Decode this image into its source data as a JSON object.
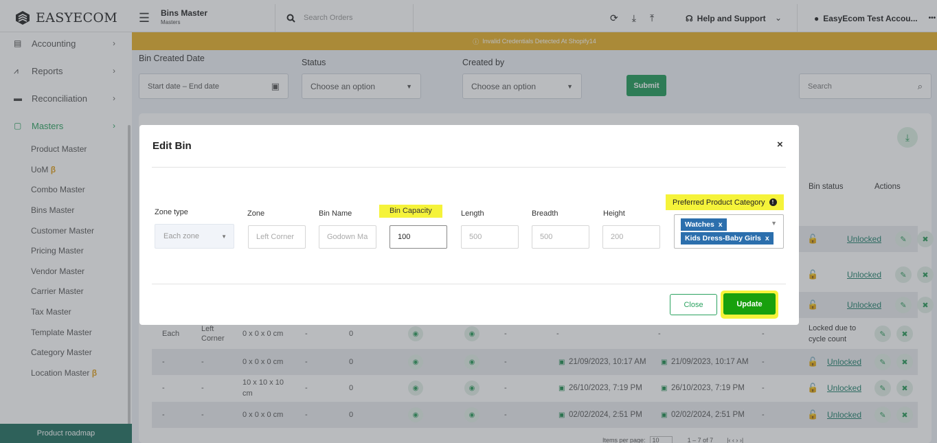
{
  "header": {
    "logo_text": "EASYECOM",
    "page_title": "Bins Master",
    "page_subtitle": "Masters",
    "search_placeholder": "Search Orders",
    "help_label": "Help and Support",
    "account_label": "EasyEcom Test Accou...",
    "more_label": "•••"
  },
  "sidebar": {
    "items": [
      {
        "label": "Accounting",
        "icon": "ledger-icon"
      },
      {
        "label": "Reports",
        "icon": "chart-icon"
      },
      {
        "label": "Reconciliation",
        "icon": "wallet-icon"
      },
      {
        "label": "Masters",
        "icon": "folder-icon"
      }
    ],
    "subitems": [
      {
        "label": "Product Master",
        "beta": ""
      },
      {
        "label": "UoM",
        "beta": "β"
      },
      {
        "label": "Combo Master",
        "beta": ""
      },
      {
        "label": "Bins Master",
        "beta": ""
      },
      {
        "label": "Customer Master",
        "beta": ""
      },
      {
        "label": "Pricing Master",
        "beta": ""
      },
      {
        "label": "Vendor Master",
        "beta": ""
      },
      {
        "label": "Carrier Master",
        "beta": ""
      },
      {
        "label": "Tax Master",
        "beta": ""
      },
      {
        "label": "Template Master",
        "beta": ""
      },
      {
        "label": "Category Master",
        "beta": ""
      },
      {
        "label": "Location Master",
        "beta": "β"
      }
    ],
    "roadmap_label": "Product roadmap"
  },
  "banner": {
    "text": "Invalid Credentials Detected At Shopify14"
  },
  "filters": {
    "bin_created_date_label": "Bin Created Date",
    "date_placeholder": "Start date – End date",
    "status_label": "Status",
    "status_placeholder": "Choose an option",
    "created_by_label": "Created by",
    "created_by_placeholder": "Choose an option",
    "submit_label": "Submit",
    "search_placeholder": "Search"
  },
  "table": {
    "bin_status_header": "Bin status",
    "actions_header": "Actions",
    "rows": [
      {
        "zone_type": "Each",
        "zone": "Left Corner",
        "dims": "0 x 0 x 0 cm",
        "c4": "-",
        "c5": "0",
        "c8": "-",
        "created": "-",
        "updated": "-",
        "c11": "-",
        "status": "Locked due to cycle count",
        "locked": true
      },
      {
        "zone_type": "-",
        "zone": "-",
        "dims": "0 x 0 x 0 cm",
        "c4": "-",
        "c5": "0",
        "c8": "-",
        "created": "21/09/2023, 10:17 AM",
        "updated": "21/09/2023, 10:17 AM",
        "c11": "-",
        "status": "Unlocked",
        "locked": false
      },
      {
        "zone_type": "-",
        "zone": "-",
        "dims": "10 x 10 x 10 cm",
        "c4": "-",
        "c5": "0",
        "c8": "-",
        "created": "26/10/2023, 7:19 PM",
        "updated": "26/10/2023, 7:19 PM",
        "c11": "-",
        "status": "Unlocked",
        "locked": false
      },
      {
        "zone_type": "-",
        "zone": "-",
        "dims": "0 x 0 x 0 cm",
        "c4": "-",
        "c5": "0",
        "c8": "-",
        "created": "02/02/2024, 2:51 PM",
        "updated": "02/02/2024, 2:51 PM",
        "c11": "-",
        "status": "Unlocked",
        "locked": false
      }
    ],
    "upper_status": [
      "Unlocked",
      "Unlocked",
      "Unlocked"
    ],
    "pager": {
      "label": "Items per page:",
      "size": "10",
      "range": "1 – 7 of 7"
    }
  },
  "modal": {
    "title": "Edit Bin",
    "close_icon": "×",
    "zone_type_label": "Zone type",
    "zone_type_value": "Each zone",
    "zone_label": "Zone",
    "zone_placeholder": "Left Corner",
    "bin_name_label": "Bin Name",
    "bin_name_placeholder": "Godown Ma",
    "bin_capacity_label": "Bin Capacity",
    "bin_capacity_value": "100",
    "length_label": "Length",
    "length_placeholder": "500",
    "breadth_label": "Breadth",
    "breadth_placeholder": "500",
    "height_label": "Height",
    "height_placeholder": "200",
    "ppc_label": "Preferred Product Category",
    "ppc_tags": [
      "Watches",
      "Kids Dress-Baby Girls"
    ],
    "tag_remove": "x",
    "close_button": "Close",
    "update_button": "Update"
  },
  "colors": {
    "accent": "#2aa25f",
    "banner": "#e7b128",
    "highlight": "#f5f33a",
    "update": "#18a00d"
  }
}
